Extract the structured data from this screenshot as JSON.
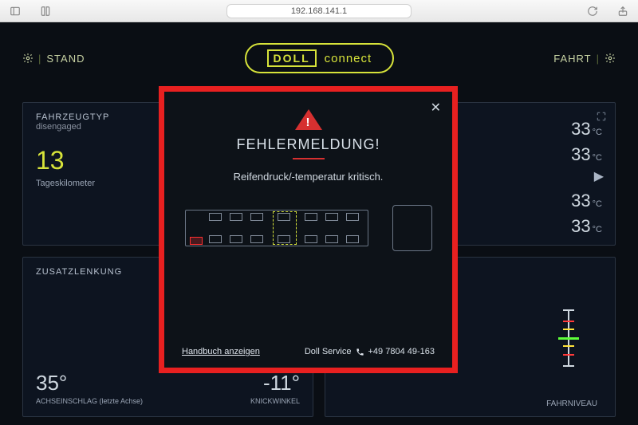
{
  "browser": {
    "url": "192.168.141.1"
  },
  "header": {
    "left_label": "STAND",
    "right_label": "FAHRT",
    "logo_primary": "DOLL",
    "logo_secondary": "connect"
  },
  "cards": {
    "vehicle": {
      "title": "FAHRZEUGTYP",
      "status": "disengaged",
      "odometer_value": "13",
      "odometer_label": "Tageskilometer"
    },
    "temps": {
      "top": [
        {
          "value": "33",
          "unit": "°C"
        },
        {
          "value": "33",
          "unit": "°C"
        }
      ],
      "bottom": [
        {
          "value": "33",
          "unit": "°C"
        },
        {
          "value": "33",
          "unit": "°C"
        }
      ]
    },
    "steering": {
      "title": "ZUSATZLENKUNG",
      "left_value": "35°",
      "left_label": "ACHSEINSCHLAG (letzte Achse)",
      "right_value": "-11°",
      "right_label": "KNICKWINKEL"
    },
    "level": {
      "label": "FAHRNIVEAU"
    }
  },
  "modal": {
    "title": "FEHLERMELDUNG!",
    "message": "Reifendruck/-temperatur kritisch.",
    "handbook_link": "Handbuch anzeigen",
    "service_name": "Doll Service",
    "service_phone": "+49 7804 49-163"
  }
}
